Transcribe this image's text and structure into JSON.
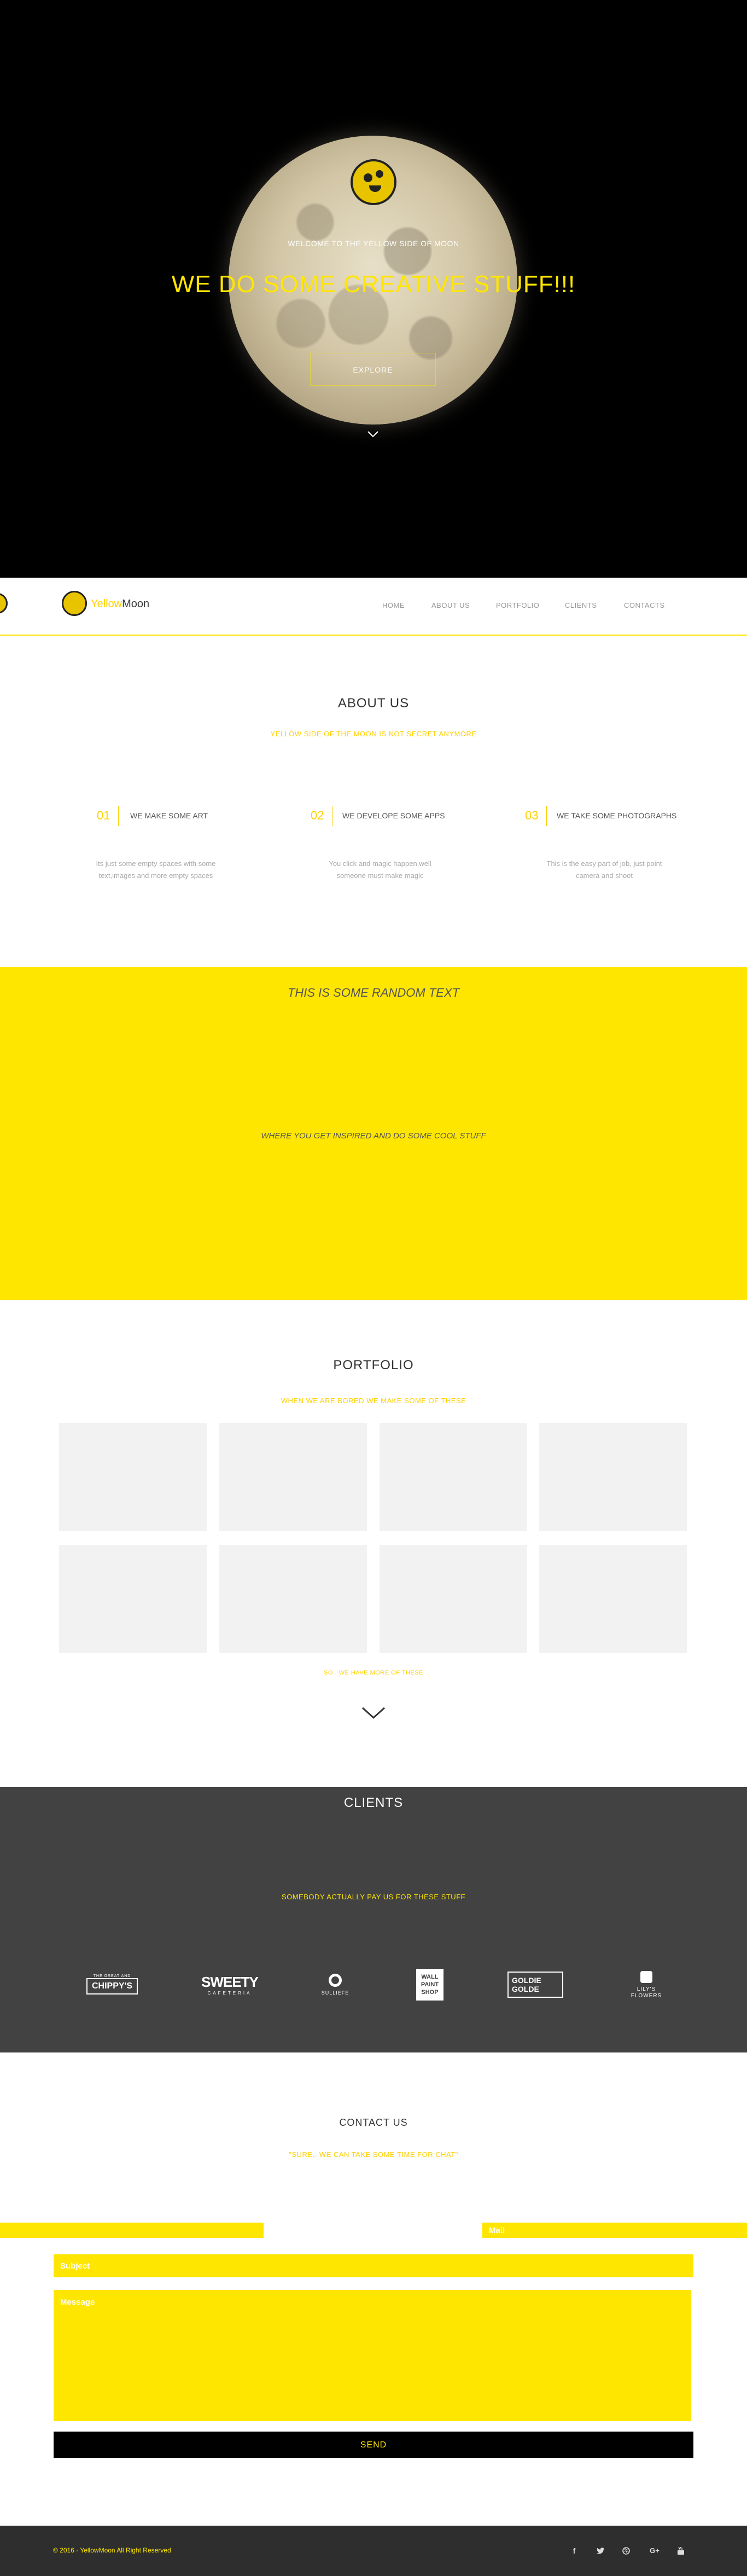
{
  "hero": {
    "welcome": "WELCOME TO THE YELLOW SIDE OF MOON",
    "headline": "WE DO SOME CREATIVE STUFF!!!",
    "cta": "EXPLORE"
  },
  "nav": {
    "brand_yellow": "YellowMoon",
    "brand_dark": "",
    "brand_parts": [
      "Yellow",
      "Moon"
    ],
    "links": [
      "HOME",
      "ABOUT US",
      "PORTFOLIO",
      "CLIENTS",
      "CONTACTS"
    ]
  },
  "about": {
    "title": "ABOUT US",
    "subtitle": "YELLOW SIDE OF THE MOON IS NOT SECRET ANYMORE",
    "services": [
      {
        "num": "01",
        "title": "WE MAKE SOME ART",
        "desc_line1": "Its just some empty spaces with some",
        "desc_line2": "text,images and more empty spaces"
      },
      {
        "num": "02",
        "title": "WE DEVELOPE SOME APPS",
        "desc_line1": "You click and magic happen,well",
        "desc_line2": "someone must make magic"
      },
      {
        "num": "03",
        "title": "WE TAKE SOME PHOTOGRAPHS",
        "desc_line1": "This is the easy part of job, just point",
        "desc_line2": "camera and shoot"
      }
    ]
  },
  "band": {
    "heading": "THIS IS SOME RANDOM TEXT",
    "tagline": "WHERE YOU GET INSPIRED AND DO SOME COOL STUFF"
  },
  "portfolio": {
    "title": "PORTFOLIO",
    "subtitle": "WHEN WE ARE BORED WE MAKE SOME OF THESE",
    "more": "SO.. WE HAVE MORE OF THESE"
  },
  "clients": {
    "title": "CLIENTS",
    "subtitle": "SOMEBODY ACTUALLY PAY US FOR THESE STUFF",
    "logos": [
      {
        "top": "THE GREAT AND",
        "main": "CHIPPY'S"
      },
      {
        "main": "SWEETY",
        "bottom": "CAFETERIA"
      },
      {
        "main": "SULLIEFE"
      },
      {
        "main": "WALL PAINT SHOP"
      },
      {
        "main": "GOLDIE GOLDE"
      },
      {
        "main": "LILY'S FLOWERS"
      }
    ]
  },
  "contact": {
    "title": "CONTACT US",
    "subtitle": "\"SURE.. WE CAN TAKE SOME TIME FOR CHAT\"",
    "name_placeholder": "",
    "mail_placeholder": "Mail",
    "subject_placeholder": "Subject",
    "message_placeholder": "Message",
    "send": "SEND"
  },
  "footer": {
    "copyright": "© 2016 - YellowMoon All Right Reserved",
    "social": [
      "facebook-icon",
      "twitter-icon",
      "dribbble-icon",
      "google-plus-icon",
      "youtube-icon"
    ]
  },
  "colors": {
    "accent": "#ffe600",
    "dark": "#424242",
    "footer": "#2e2e2e"
  }
}
